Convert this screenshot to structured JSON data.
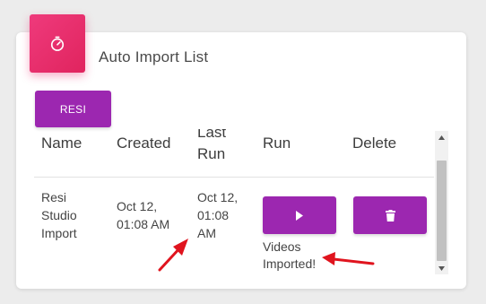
{
  "card": {
    "title": "Auto Import List",
    "icon": "timer-icon",
    "accent_color": "#e91e63"
  },
  "toolbar": {
    "resi_label": "RESI",
    "button_color": "#9c27b0"
  },
  "table": {
    "headers": {
      "name": "Name",
      "created": "Created",
      "last_run": "Last Run",
      "run": "Run",
      "delete": "Delete"
    },
    "rows": [
      {
        "name_line1": "Resi",
        "name_line2": "Studio",
        "name_line3": "Import",
        "created_line1": "Oct 12,",
        "created_line2": "01:08 AM",
        "last_run_line1": "Oct 12,",
        "last_run_line2": "01:08",
        "last_run_line3": "AM",
        "run_icon": "play-icon",
        "delete_icon": "trash-icon",
        "status_line1": "Videos",
        "status_line2": "Imported!"
      }
    ]
  },
  "annotations": {
    "arrow_color": "#e0141e"
  }
}
